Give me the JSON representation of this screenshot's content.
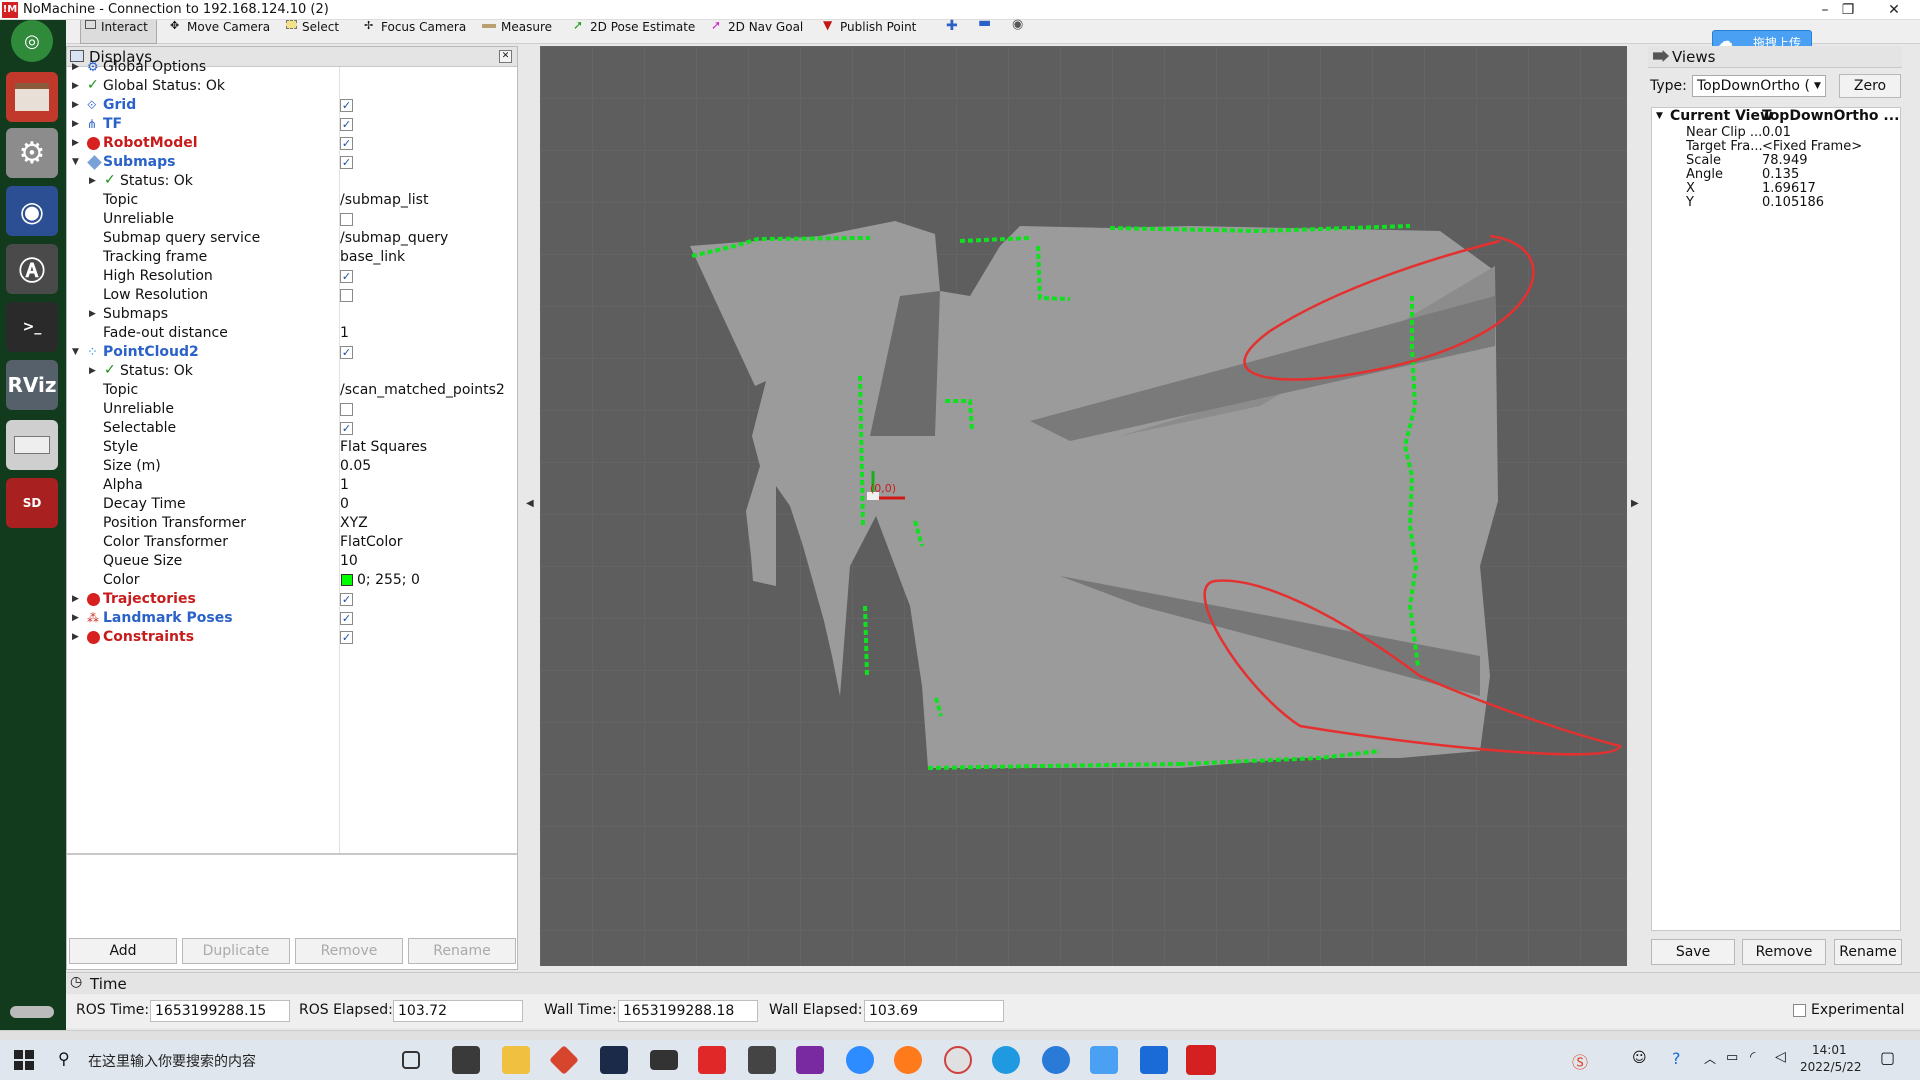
{
  "window": {
    "title": "NoMachine - Connection to 192.168.124.10 (2)",
    "logo": "!M",
    "minimize": "–",
    "restore": "❐",
    "close": "✕"
  },
  "toolbar": {
    "tools": [
      "Interact",
      "Move Camera",
      "Select",
      "Focus Camera",
      "Measure",
      "2D Pose Estimate",
      "2D Nav Goal",
      "Publish Point"
    ]
  },
  "upload_badge": "拖拽上传",
  "displays": {
    "title": "Displays",
    "rows": [
      {
        "label": "Global Options",
        "value": ""
      },
      {
        "label": "Global Status: Ok",
        "value": ""
      },
      {
        "label": "Grid",
        "value": ""
      },
      {
        "label": "TF",
        "value": ""
      },
      {
        "label": "RobotModel",
        "value": ""
      },
      {
        "label": "Submaps",
        "value": ""
      },
      {
        "label": "Status: Ok",
        "value": ""
      },
      {
        "label": "Topic",
        "value": "/submap_list"
      },
      {
        "label": "Unreliable",
        "value": ""
      },
      {
        "label": "Submap query service",
        "value": "/submap_query"
      },
      {
        "label": "Tracking frame",
        "value": "base_link"
      },
      {
        "label": "High Resolution",
        "value": ""
      },
      {
        "label": "Low Resolution",
        "value": ""
      },
      {
        "label": "Submaps",
        "value": ""
      },
      {
        "label": "Fade-out distance",
        "value": "1"
      },
      {
        "label": "PointCloud2",
        "value": ""
      },
      {
        "label": "Status: Ok",
        "value": ""
      },
      {
        "label": "Topic",
        "value": "/scan_matched_points2"
      },
      {
        "label": "Unreliable",
        "value": ""
      },
      {
        "label": "Selectable",
        "value": ""
      },
      {
        "label": "Style",
        "value": "Flat Squares"
      },
      {
        "label": "Size (m)",
        "value": "0.05"
      },
      {
        "label": "Alpha",
        "value": "1"
      },
      {
        "label": "Decay Time",
        "value": "0"
      },
      {
        "label": "Position Transformer",
        "value": "XYZ"
      },
      {
        "label": "Color Transformer",
        "value": "FlatColor"
      },
      {
        "label": "Queue Size",
        "value": "10"
      },
      {
        "label": "Color",
        "value": "0; 255; 0"
      },
      {
        "label": "Trajectories",
        "value": ""
      },
      {
        "label": "Landmark Poses",
        "value": ""
      },
      {
        "label": "Constraints",
        "value": ""
      }
    ],
    "buttons": {
      "add": "Add",
      "duplicate": "Duplicate",
      "remove": "Remove",
      "rename": "Rename"
    }
  },
  "map": {
    "origin_label": "(0,0)",
    "scan_color": "#00ff00",
    "annotation_color": "#e53030"
  },
  "views": {
    "title": "Views",
    "type_label": "Type:",
    "type_value": "TopDownOrtho (",
    "zero": "Zero",
    "current_view": {
      "label": "Current View",
      "value": "TopDownOrtho ..."
    },
    "props": [
      {
        "label": "Near Clip ...",
        "value": "0.01"
      },
      {
        "label": "Target Fra...",
        "value": "<Fixed Frame>"
      },
      {
        "label": "Scale",
        "value": "78.949"
      },
      {
        "label": "Angle",
        "value": "0.135"
      },
      {
        "label": "X",
        "value": "1.69617"
      },
      {
        "label": "Y",
        "value": "0.105186"
      }
    ],
    "buttons": {
      "save": "Save",
      "remove": "Remove",
      "rename": "Rename"
    }
  },
  "time": {
    "title": "Time",
    "ros_time_label": "ROS Time:",
    "ros_time": "1653199288.15",
    "ros_elapsed_label": "ROS Elapsed:",
    "ros_elapsed": "103.72",
    "wall_time_label": "Wall Time:",
    "wall_time": "1653199288.18",
    "wall_elapsed_label": "Wall Elapsed:",
    "wall_elapsed": "103.69",
    "experimental": "Experimental"
  },
  "taskbar": {
    "search_placeholder": "在这里输入你要搜索的内容",
    "clock_time": "14:01",
    "clock_date": "2022/5/22"
  }
}
